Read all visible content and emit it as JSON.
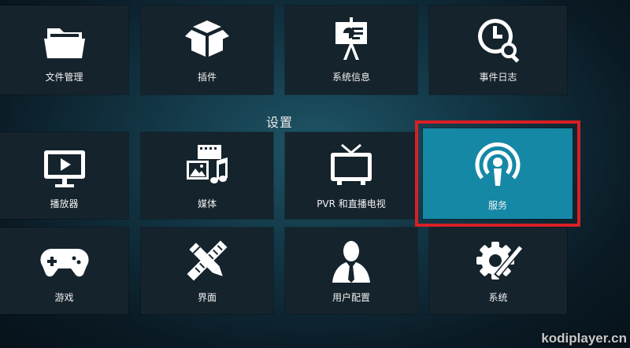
{
  "section_title": "设置",
  "top_row": [
    {
      "label": "文件管理",
      "icon": "folder-icon"
    },
    {
      "label": "插件",
      "icon": "box-icon"
    },
    {
      "label": "系统信息",
      "icon": "presentation-board-icon"
    },
    {
      "label": "事件日志",
      "icon": "clock-search-icon"
    }
  ],
  "mid_row": [
    {
      "label": "播放器",
      "icon": "monitor-play-icon"
    },
    {
      "label": "媒体",
      "icon": "media-icon"
    },
    {
      "label": "PVR 和直播电视",
      "icon": "tv-icon"
    },
    {
      "label": "服务",
      "icon": "broadcast-icon",
      "focused": true
    }
  ],
  "bottom_row": [
    {
      "label": "游戏",
      "icon": "gamepad-icon"
    },
    {
      "label": "界面",
      "icon": "pencil-ruler-icon"
    },
    {
      "label": "用户配置",
      "icon": "user-profile-icon"
    },
    {
      "label": "系统",
      "icon": "gear-tools-icon"
    }
  ],
  "watermark": "kodiplayer.cn",
  "colors": {
    "focus_tile": "#1588a5",
    "focus_border": "#d81f26",
    "tile": "#15232c"
  }
}
